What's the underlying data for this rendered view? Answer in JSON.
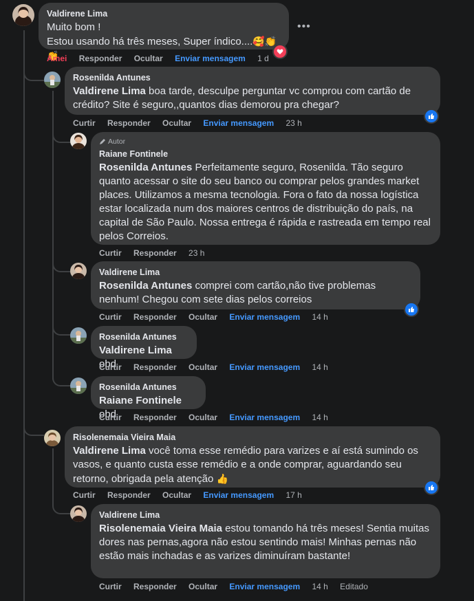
{
  "comments": [
    {
      "author": "Valdirene Lima",
      "line1": "Muito bom !",
      "line2": "Estou usando há três meses, Super índico....",
      "emoji": "🥰👏👏",
      "actions": {
        "react": "Amei",
        "reply": "Responder",
        "hide": "Ocultar",
        "message": "Enviar mensagem",
        "time": "1 d"
      },
      "reaction": "heart-icon"
    },
    {
      "author": "Rosenilda Antunes",
      "mention": "Valdirene Lima",
      "text": " boa tarde, desculpe perguntar vc comprou com cartão de crédito? Site é seguro,,quantos dias demorou pra chegar?",
      "actions": {
        "like": "Curtir",
        "reply": "Responder",
        "hide": "Ocultar",
        "message": "Enviar mensagem",
        "time": "23 h"
      },
      "reaction": "like-icon"
    },
    {
      "badge": "Autor",
      "author": "Raiane Fontinele",
      "mention": "Rosenilda Antunes",
      "text": " Perfeitamente seguro, Rosenilda. Tão seguro quanto acessar o site do seu banco ou comprar pelos grandes market places. Utilizamos a mesma tecnologia. Fora o fato da nossa logística estar localizada num dos maiores centros de distribuição do país, na capital de São Paulo. Nossa entrega é rápida e rastreada em tempo real pelos Correios.",
      "actions": {
        "like": "Curtir",
        "reply": "Responder",
        "time": "23 h"
      }
    },
    {
      "author": "Valdirene Lima",
      "mention": "Rosenilda Antunes",
      "text": " comprei com cartão,não tive problemas nenhum! Chegou com sete dias pelos correios",
      "actions": {
        "like": "Curtir",
        "reply": "Responder",
        "hide": "Ocultar",
        "message": "Enviar mensagem",
        "time": "14 h"
      },
      "reaction": "like-icon"
    },
    {
      "author": "Rosenilda Antunes",
      "mention": "Valdirene Lima",
      "text": " obd",
      "actions": {
        "like": "Curtir",
        "reply": "Responder",
        "hide": "Ocultar",
        "message": "Enviar mensagem",
        "time": "14 h"
      }
    },
    {
      "author": "Rosenilda Antunes",
      "mention": "Raiane Fontinele",
      "text": " obd",
      "actions": {
        "like": "Curtir",
        "reply": "Responder",
        "hide": "Ocultar",
        "message": "Enviar mensagem",
        "time": "14 h"
      }
    },
    {
      "author": "Risolenemaia Vieira Maia",
      "mention": "Valdirene Lima",
      "text": " você toma esse remédio para varizes e aí está sumindo os vasos, e quanto custa esse remédio e a onde comprar, aguardando seu retorno, obrigada pela atenção",
      "emoji": "👍",
      "actions": {
        "like": "Curtir",
        "reply": "Responder",
        "hide": "Ocultar",
        "message": "Enviar mensagem",
        "time": "17 h"
      },
      "reaction": "like-icon"
    },
    {
      "author": "Valdirene Lima",
      "mention": "Risolenemaia Vieira Maia",
      "text": " estou tomando há três meses! Sentia muitas dores nas pernas,agora não estou sentindo mais! Minhas pernas não estão mais inchadas e as varizes diminuíram bastante!",
      "actions": {
        "like": "Curtir",
        "reply": "Responder",
        "hide": "Ocultar",
        "message": "Enviar mensagem",
        "time": "14 h",
        "edited": "Editado"
      }
    }
  ],
  "colors": {
    "bubble": "#3a3b3c",
    "link": "#4599ff",
    "love": "#f33e58",
    "like": "#1877f2",
    "background": "#18191a"
  }
}
